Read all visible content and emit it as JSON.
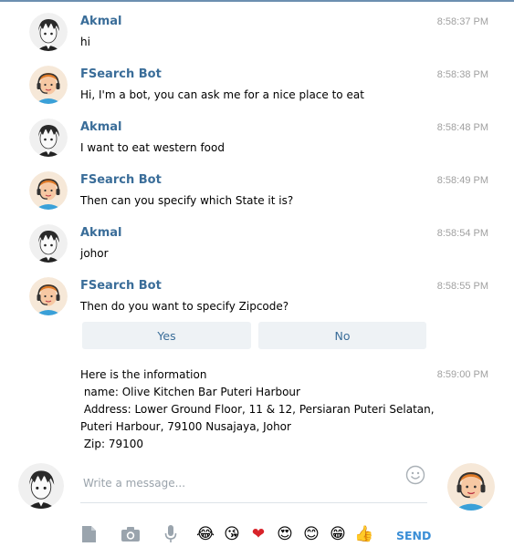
{
  "messages": [
    {
      "sender": "Akmal",
      "time": "8:58:37 PM",
      "text": "hi",
      "avatar": "user-avatar"
    },
    {
      "sender": "FSearch Bot",
      "time": "8:58:38 PM",
      "text": "Hi, I'm a bot, you can ask me for a nice place to eat",
      "avatar": "bot-avatar"
    },
    {
      "sender": "Akmal",
      "time": "8:58:48 PM",
      "text": "I want to eat western food",
      "avatar": "user-avatar"
    },
    {
      "sender": "FSearch Bot",
      "time": "8:58:49 PM",
      "text": "Then can you specify which State it is?",
      "avatar": "bot-avatar"
    },
    {
      "sender": "Akmal",
      "time": "8:58:54 PM",
      "text": "johor",
      "avatar": "user-avatar"
    },
    {
      "sender": "FSearch Bot",
      "time": "8:58:55 PM",
      "text": "Then do you want to specify Zipcode?",
      "avatar": "bot-avatar"
    }
  ],
  "keyboard": {
    "yes": "Yes",
    "no": "No"
  },
  "info": {
    "time": "8:59:00 PM",
    "lines": [
      "Here is the information",
      " name: Olive Kitchen Bar Puteri Harbour",
      " Address: Lower Ground Floor, 11 & 12, Persiaran Puteri Selatan,",
      "Puteri Harbour, 79100 Nusajaya, Johor",
      " Zip: 79100"
    ]
  },
  "composer": {
    "placeholder": "Write a message...",
    "send_label": "SEND",
    "tools": [
      "document-icon",
      "camera-icon",
      "microphone-icon"
    ],
    "emojis": [
      "😂",
      "😘",
      "❤",
      "😍",
      "😊",
      "😁",
      "👍"
    ]
  },
  "colors": {
    "accent": "#3a6d99",
    "send": "#3a8ed6",
    "button_bg": "#eef2f5"
  }
}
